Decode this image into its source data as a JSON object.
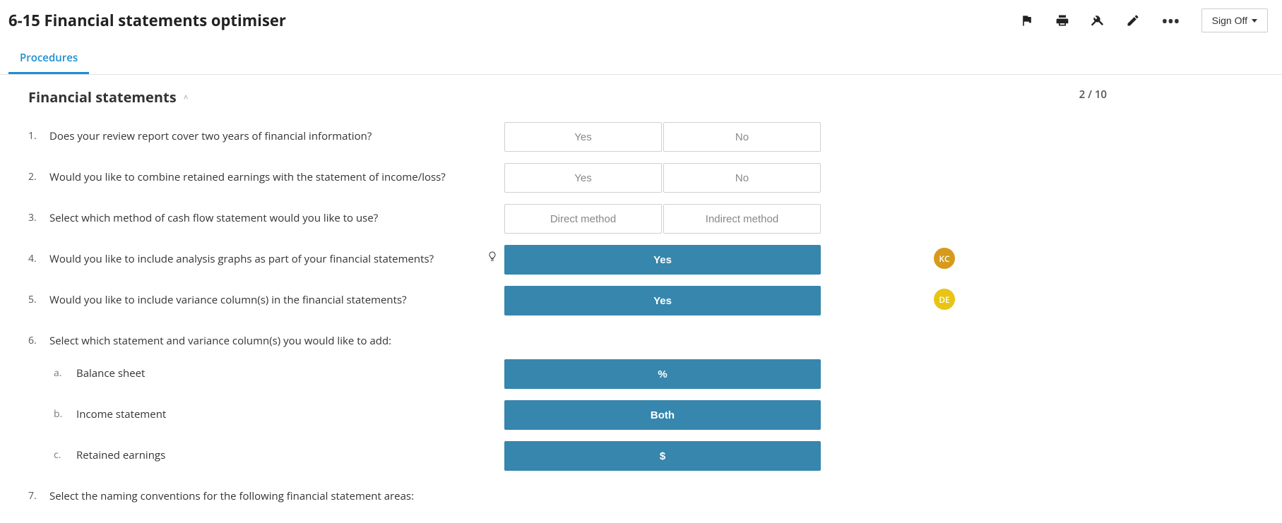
{
  "header": {
    "title": "6-15 Financial statements optimiser",
    "signoff_label": "Sign Off"
  },
  "tabs": {
    "procedures_label": "Procedures"
  },
  "section": {
    "title": "Financial statements",
    "progress": "2 / 10"
  },
  "questions": {
    "q1": {
      "num": "1.",
      "text": "Does your review report cover two years of financial information?",
      "opt_yes": "Yes",
      "opt_no": "No"
    },
    "q2": {
      "num": "2.",
      "text": "Would you like to combine retained earnings with the statement of income/loss?",
      "opt_yes": "Yes",
      "opt_no": "No"
    },
    "q3": {
      "num": "3.",
      "text": "Select which method of cash flow statement would you like to use?",
      "opt_a": "Direct method",
      "opt_b": "Indirect method"
    },
    "q4": {
      "num": "4.",
      "text": "Would you like to include analysis graphs as part of your financial statements?",
      "selected": "Yes",
      "avatar": "KC"
    },
    "q5": {
      "num": "5.",
      "text": "Would you like to include variance column(s) in the financial statements?",
      "selected": "Yes",
      "avatar": "DE"
    },
    "q6": {
      "num": "6.",
      "text": "Select which statement and variance column(s) you would like to add:",
      "a": {
        "num": "a.",
        "text": "Balance sheet",
        "selected": "%"
      },
      "b": {
        "num": "b.",
        "text": "Income statement",
        "selected": "Both"
      },
      "c": {
        "num": "c.",
        "text": "Retained earnings",
        "selected": "$"
      }
    },
    "q7": {
      "num": "7.",
      "text": "Select the naming conventions for the following financial statement areas:"
    }
  }
}
